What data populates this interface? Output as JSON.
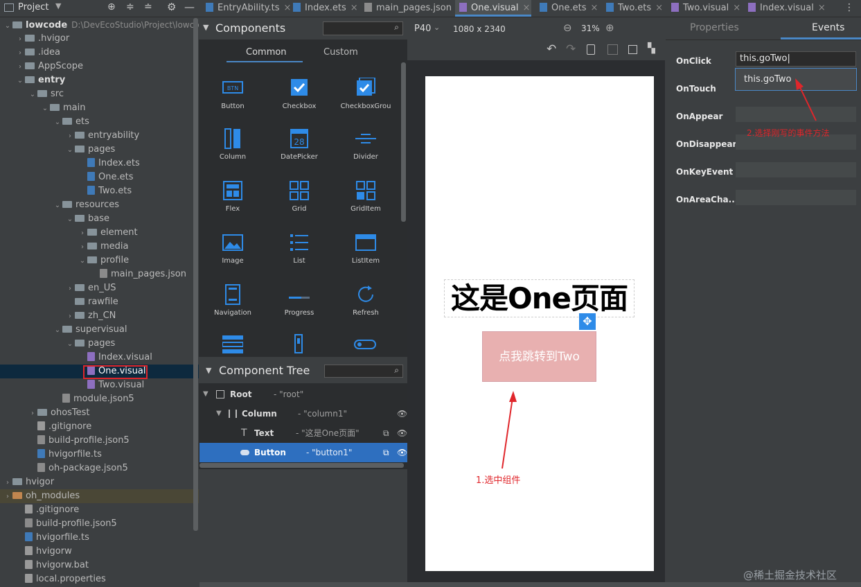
{
  "project_panel": {
    "title": "Project",
    "tree": [
      {
        "label": "lowcode",
        "path": "D:\\DevEcoStudio\\Project\\lowcode",
        "bold": true
      },
      {
        "label": ".hvigor"
      },
      {
        "label": ".idea"
      },
      {
        "label": "AppScope"
      },
      {
        "label": "entry",
        "bold": true
      },
      {
        "label": "src"
      },
      {
        "label": "main"
      },
      {
        "label": "ets"
      },
      {
        "label": "entryability"
      },
      {
        "label": "pages"
      },
      {
        "label": "Index.ets"
      },
      {
        "label": "One.ets"
      },
      {
        "label": "Two.ets"
      },
      {
        "label": "resources"
      },
      {
        "label": "base"
      },
      {
        "label": "element"
      },
      {
        "label": "media"
      },
      {
        "label": "profile"
      },
      {
        "label": "main_pages.json"
      },
      {
        "label": "en_US"
      },
      {
        "label": "rawfile"
      },
      {
        "label": "zh_CN"
      },
      {
        "label": "supervisual"
      },
      {
        "label": "pages"
      },
      {
        "label": "Index.visual"
      },
      {
        "label": "One.visual"
      },
      {
        "label": "Two.visual"
      },
      {
        "label": "module.json5"
      },
      {
        "label": "ohosTest"
      },
      {
        "label": ".gitignore"
      },
      {
        "label": "build-profile.json5"
      },
      {
        "label": "hvigorfile.ts"
      },
      {
        "label": "oh-package.json5"
      },
      {
        "label": "hvigor"
      },
      {
        "label": "oh_modules"
      },
      {
        "label": ".gitignore"
      },
      {
        "label": "build-profile.json5"
      },
      {
        "label": "hvigorfile.ts"
      },
      {
        "label": "hvigorw"
      },
      {
        "label": "hvigorw.bat"
      },
      {
        "label": "local.properties"
      }
    ]
  },
  "tabs": [
    {
      "label": "EntryAbility.ts"
    },
    {
      "label": "Index.ets"
    },
    {
      "label": "main_pages.json"
    },
    {
      "label": "One.visual",
      "active": true
    },
    {
      "label": "One.ets"
    },
    {
      "label": "Two.ets"
    },
    {
      "label": "Two.visual"
    },
    {
      "label": "Index.visual"
    }
  ],
  "components_panel": {
    "title": "Components",
    "tab_common": "Common",
    "tab_custom": "Custom",
    "items": [
      "Button",
      "Checkbox",
      "CheckboxGrou",
      "Column",
      "DatePicker",
      "Divider",
      "Flex",
      "Grid",
      "GridItem",
      "Image",
      "List",
      "ListItem",
      "Navigation",
      "Progress",
      "Refresh"
    ],
    "btn_icon_text": "BTN",
    "date_icon_text": "28"
  },
  "component_tree": {
    "title": "Component Tree",
    "rows": [
      {
        "name": "Root",
        "id": "- \"root\""
      },
      {
        "name": "Column",
        "id": "- \"column1\""
      },
      {
        "name": "Text",
        "id": "- \"这是One页面\""
      },
      {
        "name": "Button",
        "id": "- \"button1\""
      }
    ]
  },
  "canvas": {
    "device": "P40",
    "resolution": "1080 x 2340",
    "zoom": "31%",
    "page_text": "这是One页面",
    "button_text": "点我跳转到Two",
    "annotation_select": "1.选中组件"
  },
  "right_panel": {
    "tab_properties": "Properties",
    "tab_events": "Events",
    "events": [
      "OnClick",
      "OnTouch",
      "OnAppear",
      "OnDisappear",
      "OnKeyEvent",
      "OnAreaCha..."
    ],
    "onclick_value": "this.goTwo",
    "dropdown_option": "this.goTwo",
    "annotation_choose": "2.选择刚写的事件方法"
  },
  "watermark": "@稀土掘金技术社区",
  "colors": {
    "accent": "#4a88c7",
    "annotation": "#e0262b",
    "button_bg": "#e8b0b0"
  }
}
